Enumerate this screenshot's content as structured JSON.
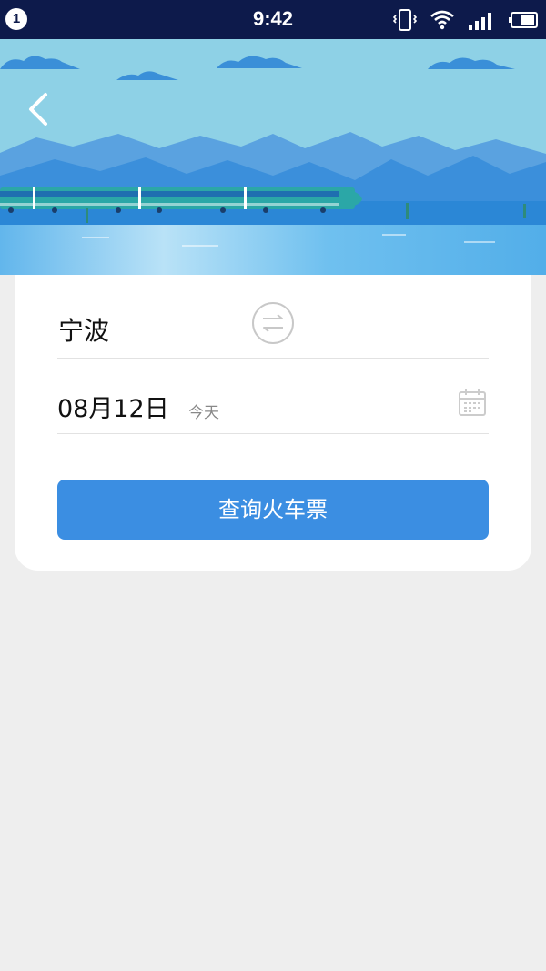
{
  "status_bar": {
    "notification_count": "1",
    "time": "9:42",
    "icons": [
      "vibrate-icon",
      "wifi-icon",
      "signal-icon",
      "battery-icon"
    ]
  },
  "header": {
    "back_icon": "chevron-left-icon"
  },
  "search_form": {
    "from_station": "宁波",
    "swap_icon": "swap-icon",
    "date": "08月12日",
    "date_hint": "今天",
    "calendar_icon": "calendar-icon",
    "search_label": "查询火车票"
  },
  "colors": {
    "status_bar": "#0d1a4b",
    "accent": "#3b8ee2",
    "sky": "#8ed1e6",
    "background": "#eeeeee"
  }
}
